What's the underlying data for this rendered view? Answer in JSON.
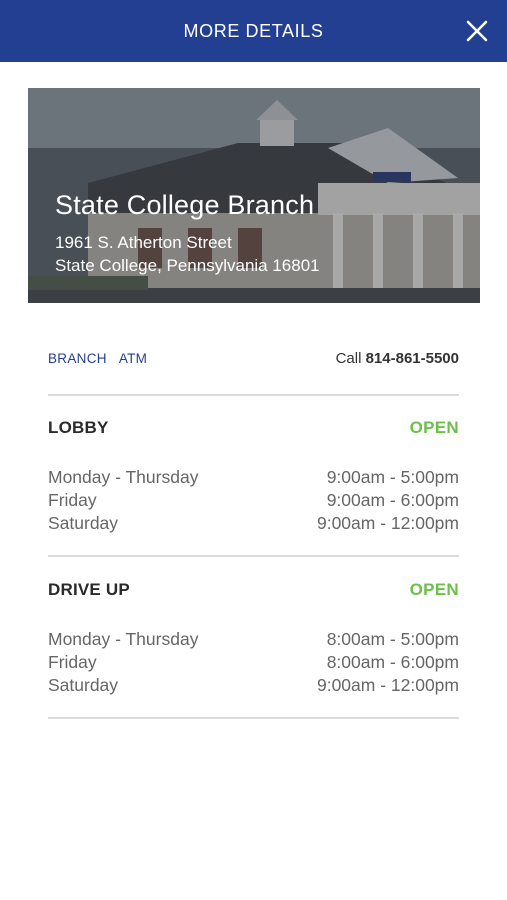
{
  "header": {
    "title": "MORE DETAILS"
  },
  "branch": {
    "name": "State College Branch",
    "address_line1": "1961 S. Atherton Street",
    "address_line2": "State College, Pennsylvania 16801"
  },
  "tabs": [
    {
      "label": "BRANCH"
    },
    {
      "label": "ATM"
    }
  ],
  "contact": {
    "call_label": "Call",
    "phone": "814-861-5500"
  },
  "lobby": {
    "title": "LOBBY",
    "status": "OPEN",
    "hours": [
      {
        "days": "Monday - Thursday",
        "time": "9:00am - 5:00pm"
      },
      {
        "days": "Friday",
        "time": "9:00am - 6:00pm"
      },
      {
        "days": "Saturday",
        "time": "9:00am - 12:00pm"
      }
    ]
  },
  "drive_up": {
    "title": "DRIVE UP",
    "status": "OPEN",
    "hours": [
      {
        "days": "Monday - Thursday",
        "time": "8:00am - 5:00pm"
      },
      {
        "days": "Friday",
        "time": "8:00am - 6:00pm"
      },
      {
        "days": "Saturday",
        "time": "9:00am - 12:00pm"
      }
    ]
  },
  "colors": {
    "header": "#233f92",
    "open": "#6cc04a",
    "link": "#233f92"
  }
}
